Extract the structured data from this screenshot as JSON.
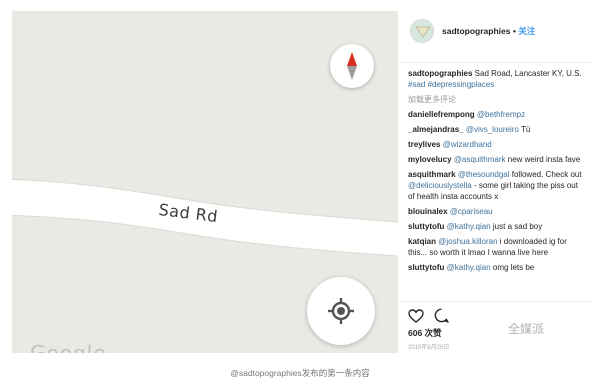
{
  "map": {
    "road_label": "Sad Rd",
    "logo_text": "Google",
    "compass_icon": "compass-icon",
    "locate_icon": "my-location-icon"
  },
  "instagram": {
    "username": "sadtopographies",
    "dot": " • ",
    "follow_label": "关注",
    "caption_user": "sadtopographies",
    "caption_text": " Sad Road, Lancaster KY, U.S. ",
    "caption_tags": "#sad #depressingplaces",
    "load_more": "加载更多评论",
    "comments": [
      {
        "user": "daniellefrempong",
        "text": "",
        "mention": "@bethfrempz"
      },
      {
        "user": "_almejandras_",
        "text": " Tü",
        "mention": "@vivs_loureiro"
      },
      {
        "user": "treylives",
        "text": "",
        "mention": "@wizardhand"
      },
      {
        "user": "mylovelucy",
        "text": " new weird insta fave",
        "mention": "@asquithmark"
      },
      {
        "user": "asquithmark",
        "text": " followed. Check out ",
        "mention": "@thesoundgal",
        "mention2": "@deliciouslystella",
        "text2": " - some girl taking the piss out of health insta accounts x"
      },
      {
        "user": "blouinalex",
        "text": "",
        "mention": "@cpariseau"
      },
      {
        "user": "sluttytofu",
        "text": " just a sad boy",
        "mention": "@kathy.qian"
      },
      {
        "user": "katqian",
        "text": " i downloaded ig for this... so worth it lmao I wanna live here",
        "mention": "@joshua.killoran"
      },
      {
        "user": "sluttytofu",
        "text": " omg lets be",
        "mention": "@kathy.qian"
      }
    ],
    "likes": "606 次赞",
    "date": "2015年8月20日",
    "watermark": "全媒派",
    "colors": {
      "link": "#3897f0",
      "mention": "#3f729b"
    }
  },
  "figure_caption": "@sadtopographies发布的第一条内容"
}
